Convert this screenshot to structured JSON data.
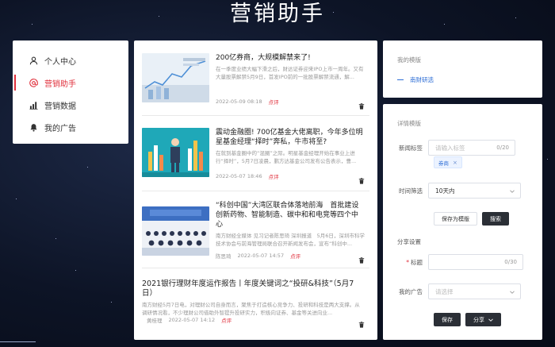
{
  "app": {
    "title": "营销助手"
  },
  "nav": {
    "items": [
      {
        "label": "个人中心",
        "icon": "user-icon",
        "active": false
      },
      {
        "label": "营销助手",
        "icon": "at-icon",
        "active": true
      },
      {
        "label": "营销数据",
        "icon": "bar-chart-icon",
        "active": false
      },
      {
        "label": "我的广告",
        "icon": "bell-icon",
        "active": false
      }
    ]
  },
  "feed": {
    "articles": [
      {
        "title": "200亿券商，大规模解禁来了!",
        "excerpt": "在一季度业绩大幅下滑之后，财达证券迎来IPO上市一周年。又有大量股票解禁5月9日，首发IPO前的一批股票解禁流通，解...",
        "author": "",
        "date": "2022-05-09 08:18",
        "tag": "点评"
      },
      {
        "title": "震动金融圈! 700亿基金大佬离职，今年多位明星基金经理“择时”奔私，牛市将至?",
        "excerpt": "在就到基金圈中的“混圈”之际。明星基金经理开始在事业上进行“择时”，5月7日凌晨，鹏方达基金公司发布公告表示，曹...",
        "author": "",
        "date": "2022-05-07 18:46",
        "tag": "点评"
      },
      {
        "title": "“科创中国”大湾区联合体落地前海　首批建设创新药物、智能制造、碳中和和电竞等四个中心",
        "excerpt": "南方财经全媒体 见习记者陈思琦 深圳报道　5月6日，深圳市科学技术协会与前海管理局联合召开新闻发布会，宣布“科创中...",
        "author": "陈思琦",
        "date": "2022-05-07 14:57",
        "tag": "点评"
      },
      {
        "title": "2021银行理财年度运作报告丨年度关键词之“投研&科技”（5月7日）",
        "excerpt": "南方财经5月7日电，对理财公司自身而言，聚焦于打造核心竞争力、投研和科技是两大支撑。从调研情况看，不少理财公司借助外智提升投研实力，积极向证券、基金等关进向业...",
        "author": "黄桂理",
        "date": "2022-05-07 14:12",
        "tag": "点评"
      }
    ]
  },
  "templates": {
    "header": "我的模版",
    "items": [
      "南财研选"
    ]
  },
  "form": {
    "header": "详情模版",
    "keyword_label": "新闻标签",
    "keyword_placeholder": "请输入标签",
    "keyword_count": "0/20",
    "chips": [
      "券商"
    ],
    "time_label": "时间筛选",
    "time_value": "10天内",
    "save_template_label": "保存为模版",
    "search_label": "搜索",
    "share_section": "分享设置",
    "title_label": "标题",
    "title_count": "0/30",
    "ad_label": "我的广告",
    "ad_placeholder": "请选择",
    "save_label": "保存",
    "share_label": "分享"
  },
  "colors": {
    "accent": "#e0303c",
    "link": "#2f6fd6",
    "dark_button": "#2b2f36"
  }
}
